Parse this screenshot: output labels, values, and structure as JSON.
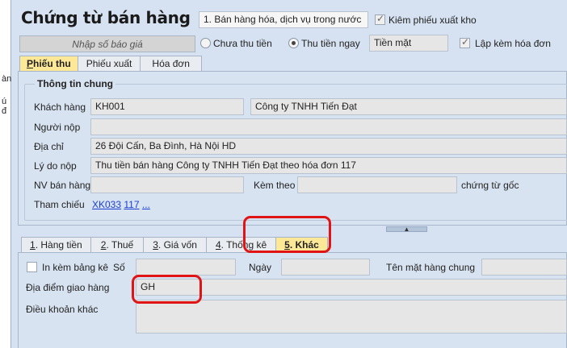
{
  "left_strip": {
    "texts": [
      "àn",
      "ú đ"
    ]
  },
  "header": {
    "title": "Chứng từ bán hàng",
    "type_select": "1. Bán hàng hóa, dịch vụ trong nước",
    "check_inventory": {
      "label": "Kiêm phiếu xuất kho",
      "checked": true
    },
    "quote_placeholder": "Nhập số báo giá",
    "payment": {
      "unpaid": "Chưa thu tiền",
      "paid": "Thu tiền ngay",
      "selected": "paid"
    },
    "payment_method": "Tiền mặt",
    "check_invoice": {
      "label": "Lập kèm hóa đơn",
      "checked": true
    }
  },
  "top_tabs": [
    {
      "label": "Phiếu thu",
      "underline": "P",
      "rest": "hiếu thu",
      "active": true
    },
    {
      "label": "Phiếu xuất",
      "underline": "",
      "rest": "Phiếu xuất",
      "active": false
    },
    {
      "label": "Hóa đơn",
      "underline": "",
      "rest": "Hóa đơn",
      "active": false
    }
  ],
  "general": {
    "group_title": "Thông tin chung",
    "customer_label": "Khách hàng",
    "customer_code": "KH001",
    "customer_name": "Công ty TNHH Tiến Đạt",
    "payer_label": "Người nộp",
    "payer": "",
    "address_label": "Địa chỉ",
    "address": "26 Đội Cấn, Ba Đình, Hà Nội HD",
    "reason_label": "Lý do nộp",
    "reason": "Thu tiền bán hàng Công ty TNHH Tiến Đạt theo hóa đơn 117",
    "salesman_label": "NV bán hàng",
    "salesman": "",
    "attached_label": "Kèm theo",
    "attached": "",
    "original_docs": "chứng từ gốc",
    "reference_label": "Tham chiếu",
    "references": [
      "XK033",
      "117",
      "..."
    ]
  },
  "bottom_tabs": [
    {
      "num": "1",
      "text": ". Hàng tiền",
      "active": false
    },
    {
      "num": "2",
      "text": ". Thuế",
      "active": false
    },
    {
      "num": "3",
      "text": ". Giá vốn",
      "active": false
    },
    {
      "num": "4",
      "text": ". Thống kê",
      "active": false
    },
    {
      "num": "5",
      "text": ". Khác",
      "active": true
    }
  ],
  "other": {
    "print_list_label": "In kèm bảng kê",
    "print_list_checked": false,
    "number_label": "Số",
    "number": "",
    "date_label": "Ngày",
    "date": "",
    "common_item_label": "Tên mặt hàng chung",
    "common_item": "",
    "delivery_label": "Địa điểm giao hàng",
    "delivery": "GH",
    "terms_label": "Điều khoản khác",
    "terms": ""
  },
  "colors": {
    "highlight": "#e01414",
    "active_tab": "#fde898",
    "panel": "#d8e3f1"
  }
}
